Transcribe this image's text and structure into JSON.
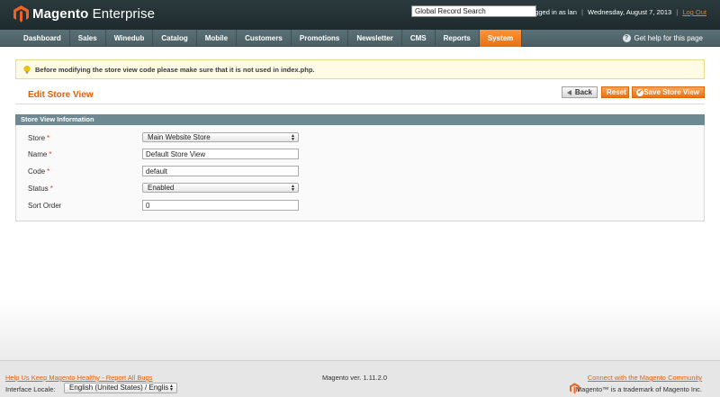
{
  "header": {
    "brand_bold": "Magento",
    "brand_light": " Enterprise",
    "search_value": "Global Record Search",
    "logged_in": "Logged in as lan",
    "date": "Wednesday, August 7, 2013",
    "logout": "Log Out"
  },
  "nav": {
    "items": [
      "Dashboard",
      "Sales",
      "Winedub",
      "Catalog",
      "Mobile",
      "Customers",
      "Promotions",
      "Newsletter",
      "CMS",
      "Reports",
      "System"
    ],
    "active_index": 10,
    "help": "Get help for this page"
  },
  "notice": {
    "text": "Before modifying the store view code please make sure that it is not used in index.php."
  },
  "page": {
    "title": "Edit Store View",
    "back": "Back",
    "reset": "Reset",
    "save": "Save Store View"
  },
  "form": {
    "section_title": "Store View Information",
    "store_label": "Store",
    "store_value": "Main Website Store",
    "name_label": "Name",
    "name_value": "Default Store View",
    "code_label": "Code",
    "code_value": "default",
    "status_label": "Status",
    "status_value": "Enabled",
    "sort_label": "Sort Order",
    "sort_value": "0",
    "required_mark": "*"
  },
  "footer": {
    "help_link": "Help Us Keep Magento Healthy - Report All Bugs",
    "version": "Magento ver. 1.11.2.0",
    "community_link": "Connect with the Magento Community",
    "locale_label": "Interface Locale:",
    "locale_value": "English (United States) / Englis",
    "trademark": "Magento™ is a trademark of Magento Inc."
  },
  "colors": {
    "accent": "#eb5e00",
    "nav_bg": "#4a5e63",
    "header_bg": "#1e2a2d",
    "section_head": "#6f8992"
  }
}
